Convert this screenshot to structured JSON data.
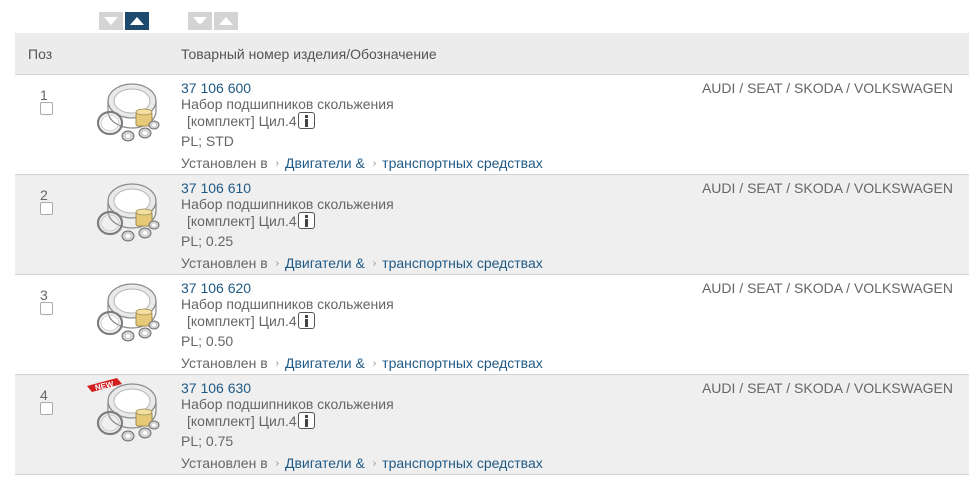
{
  "sort_controls": {
    "group1": [
      "sort-desc",
      "sort-asc"
    ],
    "group2": [
      "sort-desc",
      "sort-asc"
    ],
    "active": "group1-asc"
  },
  "header": {
    "pos": "Поз",
    "article": "Товарный номер изделия/Обозначение"
  },
  "colors": {
    "link": "#1f5a85",
    "active_sort": "#1e4a6e",
    "row_alt": "#efefef",
    "new_badge": "#d21f1f"
  },
  "rows": [
    {
      "pos": "1",
      "article_no": "37 106 600",
      "desc_line1": "Набор подшипников скольжения",
      "desc_line2": "[комплект] Цил.4",
      "variant": "PL; STD",
      "installed_label": "Установлен в",
      "link1": "Двигатели &",
      "link2": "транспортных средствах",
      "brands": "AUDI / SEAT / SKODA / VOLKSWAGEN",
      "new": false
    },
    {
      "pos": "2",
      "article_no": "37 106 610",
      "desc_line1": "Набор подшипников скольжения",
      "desc_line2": "[комплект] Цил.4",
      "variant": "PL; 0.25",
      "installed_label": "Установлен в",
      "link1": "Двигатели &",
      "link2": "транспортных средствах",
      "brands": "AUDI / SEAT / SKODA / VOLKSWAGEN",
      "new": false
    },
    {
      "pos": "3",
      "article_no": "37 106 620",
      "desc_line1": "Набор подшипников скольжения",
      "desc_line2": "[комплект] Цил.4",
      "variant": "PL; 0.50",
      "installed_label": "Установлен в",
      "link1": "Двигатели &",
      "link2": "транспортных средствах",
      "brands": "AUDI / SEAT / SKODA / VOLKSWAGEN",
      "new": false
    },
    {
      "pos": "4",
      "article_no": "37 106 630",
      "desc_line1": "Набор подшипников скольжения",
      "desc_line2": "[комплект] Цил.4",
      "variant": "PL; 0.75",
      "installed_label": "Установлен в",
      "link1": "Двигатели &",
      "link2": "транспортных средствах",
      "brands": "AUDI / SEAT / SKODA / VOLKSWAGEN",
      "new": true,
      "new_label": "NEW"
    }
  ]
}
